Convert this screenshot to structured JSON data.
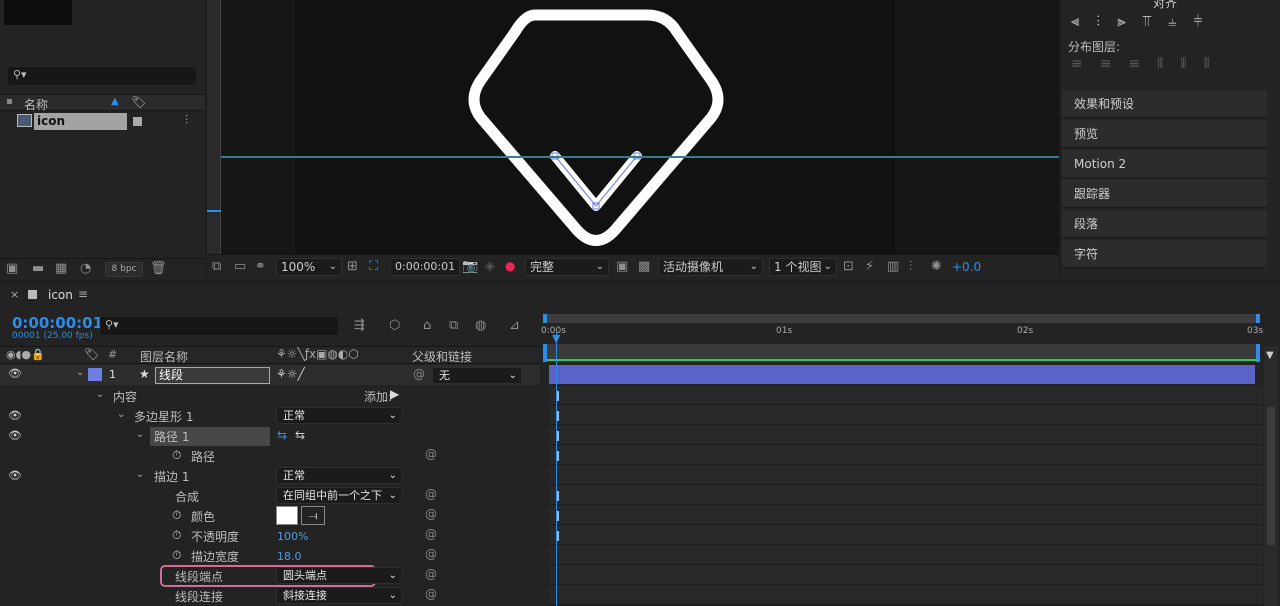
{
  "project": {
    "search_placeholder": "",
    "col_name": "名称",
    "item_name": "icon",
    "bpc": "8 bpc"
  },
  "viewer": {
    "zoom": "100%",
    "timecode": "0:00:00:01",
    "quality": "完整",
    "camera": "活动摄像机",
    "views": "1 个视图",
    "exposure": "+0.0"
  },
  "right_panel": {
    "top_tab_partial": "对齐",
    "distribute_label": "分布图层:",
    "tabs": [
      "效果和预设",
      "预览",
      "Motion 2",
      "跟踪器",
      "段落",
      "字符"
    ]
  },
  "timeline": {
    "comp_tab": "icon",
    "timecode": "0:00:00:01",
    "frames_fps": "00001 (25.00 fps)",
    "col_hash": "#",
    "col_layer_name": "图层名称",
    "col_parent": "父级和链接",
    "layer_num": "1",
    "layer_name": "线段",
    "parent_value": "无",
    "ruler": [
      "0:00s",
      "01s",
      "02s",
      "03s"
    ],
    "props": {
      "content": "内容",
      "add": "添加:",
      "star": "多边星形 1",
      "star_mode": "正常",
      "path_group": "路径 1",
      "path": "路径",
      "stroke": "描边 1",
      "stroke_mode": "正常",
      "composite": "合成",
      "composite_value": "在同组中前一个之下",
      "color": "颜色",
      "opacity": "不透明度",
      "opacity_value": "100%",
      "stroke_width": "描边宽度",
      "stroke_width_value": "18.0",
      "line_cap": "线段端点",
      "line_cap_value": "圆头端点",
      "line_join": "线段连接",
      "line_join_value": "斜接连接"
    }
  },
  "colors": {
    "accent_blue": "#2d8ceb",
    "layer_bar": "#5a63c8",
    "label_color": "#6f7fe0",
    "highlight_pink": "#d66b9a",
    "guide_line": "#2f7f90"
  }
}
